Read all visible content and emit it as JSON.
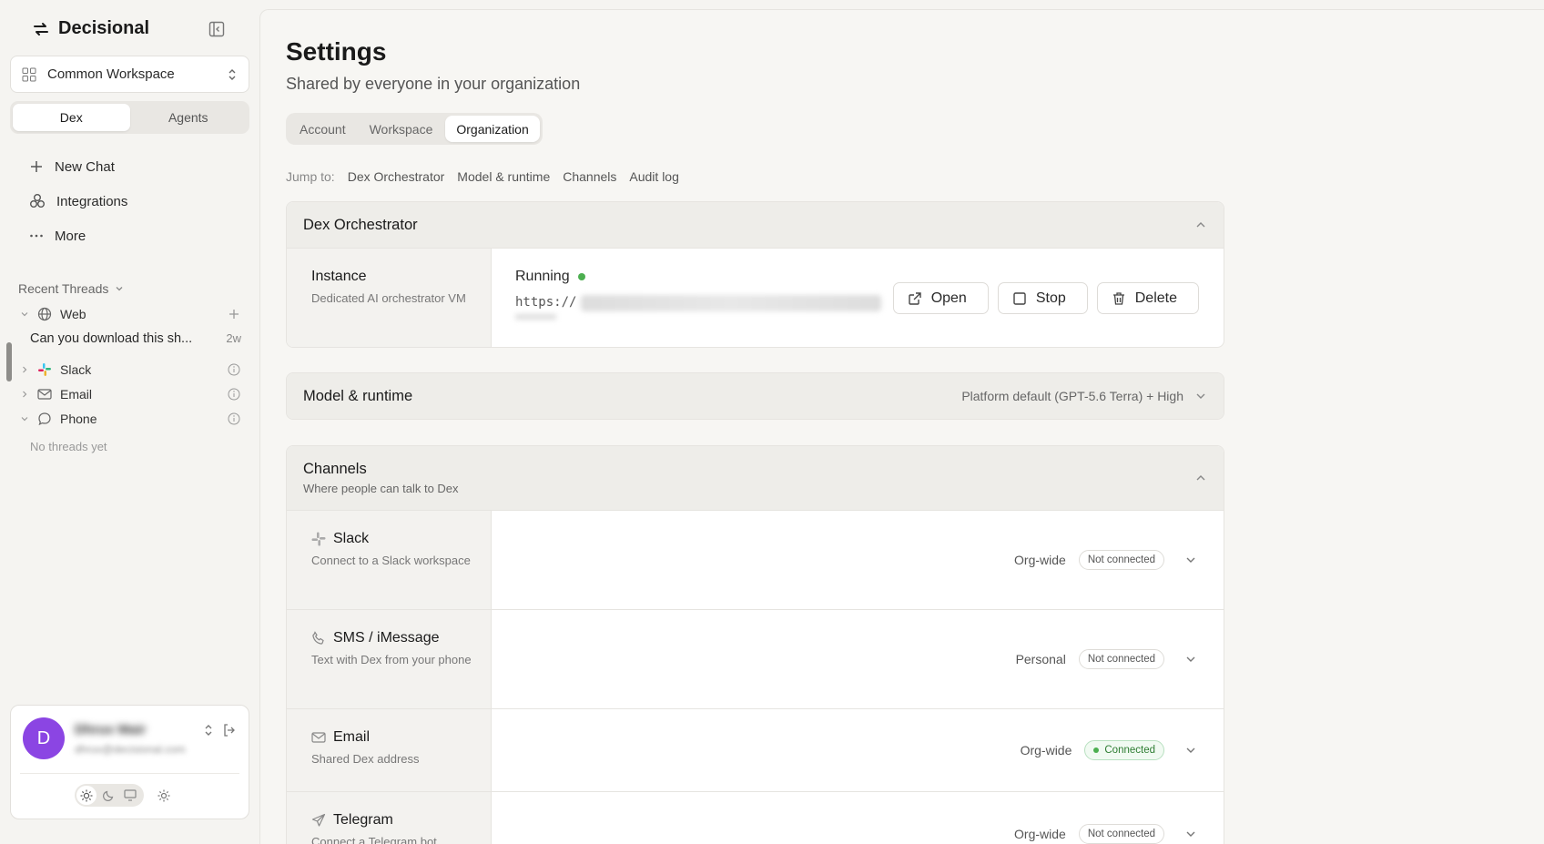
{
  "sidebar": {
    "brand": "Decisional",
    "workspace": "Common Workspace",
    "modes": [
      "Dex",
      "Agents"
    ],
    "nav": {
      "new_chat": "New Chat",
      "integrations": "Integrations",
      "more": "More"
    },
    "recent_threads": "Recent Threads",
    "groups": {
      "web": "Web",
      "slack": "Slack",
      "email": "Email",
      "phone": "Phone"
    },
    "thread": {
      "title": "Can you download this sh...",
      "age": "2w"
    },
    "no_threads": "No threads yet",
    "user": {
      "initial": "D",
      "name": "Dhruv Mair",
      "email": "dhruv@decisional.com"
    }
  },
  "page": {
    "title": "Settings",
    "subtitle": "Shared by everyone in your organization",
    "tabs": [
      "Account",
      "Workspace",
      "Organization"
    ],
    "active_tab": "Organization",
    "jump_label": "Jump to:",
    "jump_links": [
      "Dex Orchestrator",
      "Model & runtime",
      "Channels",
      "Audit log"
    ]
  },
  "orchestrator": {
    "title": "Dex Orchestrator",
    "instance": {
      "name": "Instance",
      "desc": "Dedicated AI orchestrator VM",
      "status": "Running",
      "url_prefix": "https://",
      "status_color": "#4caf50"
    },
    "buttons": {
      "open": "Open",
      "stop": "Stop",
      "delete": "Delete"
    }
  },
  "model": {
    "title": "Model & runtime",
    "value": "Platform default (GPT-5.6 Terra) + High"
  },
  "channels": {
    "title": "Channels",
    "subtitle": "Where people can talk to Dex",
    "items": [
      {
        "name": "Slack",
        "desc": "Connect to a Slack workspace",
        "scope": "Org-wide",
        "status": "Not connected",
        "icon": "slack-icon"
      },
      {
        "name": "SMS / iMessage",
        "desc": "Text with Dex from your phone",
        "scope": "Personal",
        "status": "Not connected",
        "icon": "phone-icon"
      },
      {
        "name": "Email",
        "desc": "Shared Dex address",
        "scope": "Org-wide",
        "status": "Connected",
        "icon": "mail-icon"
      },
      {
        "name": "Telegram",
        "desc": "Connect a Telegram bot",
        "scope": "Org-wide",
        "status": "Not connected",
        "icon": "send-icon"
      }
    ]
  }
}
